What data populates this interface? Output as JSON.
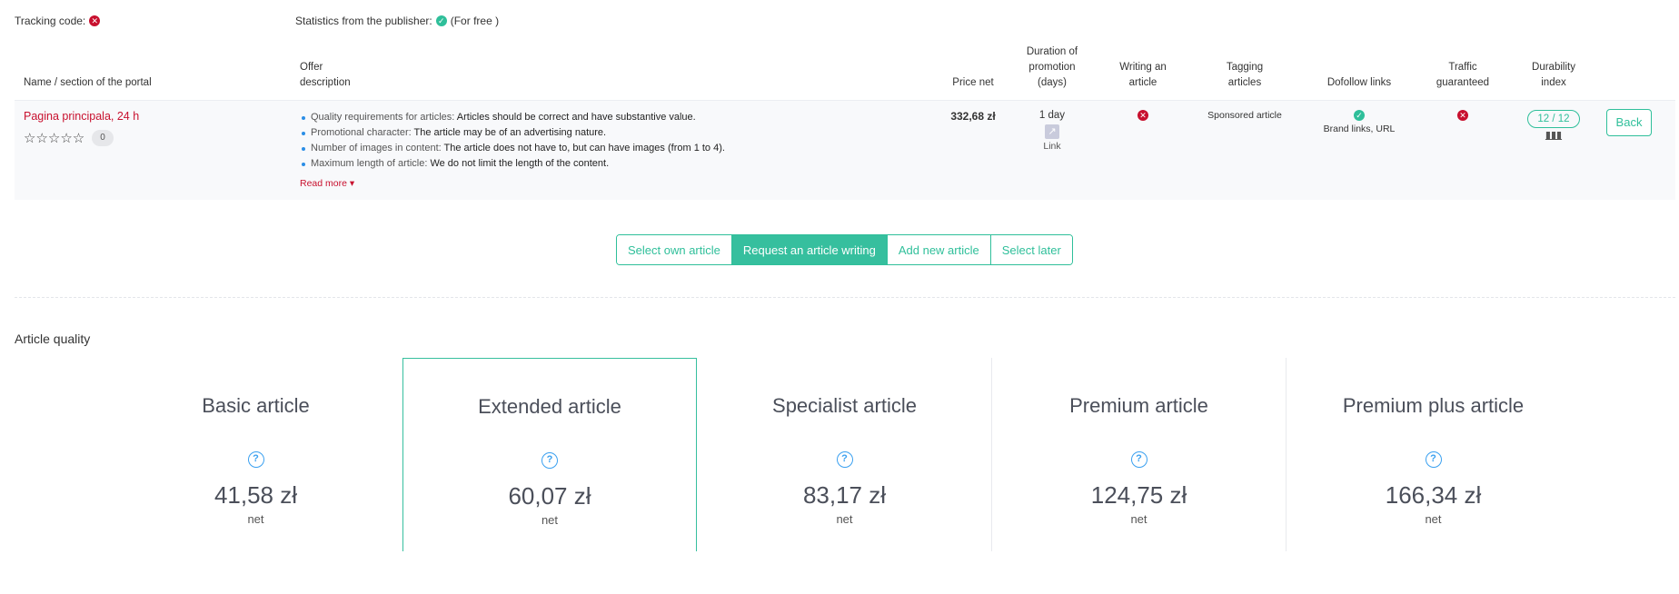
{
  "info": {
    "tracking_code_label": "Tracking code:",
    "tracking_code_status": "no",
    "statistics_label": "Statistics from the publisher:",
    "statistics_status": "yes",
    "statistics_note": "(For free )"
  },
  "table": {
    "headers": {
      "name": "Name / section of the portal",
      "offer_line1": "Offer",
      "offer_line2": "description",
      "price": "Price net",
      "duration_line1": "Duration of",
      "duration_line2": "promotion",
      "duration_line3": "(days)",
      "writing_line1": "Writing an",
      "writing_line2": "article",
      "tagging_line1": "Tagging",
      "tagging_line2": "articles",
      "dofollow": "Dofollow links",
      "traffic_line1": "Traffic",
      "traffic_line2": "guaranteed",
      "durability_line1": "Durability",
      "durability_line2": "index"
    },
    "row": {
      "portal_name": "Pagina principala, 24 h",
      "stars": "☆☆☆☆☆",
      "rating_count": "0",
      "description": [
        {
          "label": "Quality requirements for articles:",
          "value": "Articles should be correct and have substantive value."
        },
        {
          "label": "Promotional character:",
          "value": "The article may be of an advertising nature."
        },
        {
          "label": "Number of images in content:",
          "value": "The article does not have to, but can have images (from 1 to 4)."
        },
        {
          "label": "Maximum length of article:",
          "value": "We do not limit the length of the content."
        }
      ],
      "read_more": "Read more ▾",
      "price": "332,68 zł",
      "duration": "1 day",
      "duration_link": "Link",
      "writing_article": "no",
      "tagging": "Sponsored article",
      "dofollow": "yes",
      "dofollow_note": "Brand links, URL",
      "traffic_guaranteed": "no",
      "durability": "12 / 12",
      "back_button": "Back"
    }
  },
  "actions": {
    "buttons": [
      {
        "label": "Select own article",
        "active": false
      },
      {
        "label": "Request an article writing",
        "active": true
      },
      {
        "label": "Add new article",
        "active": false
      },
      {
        "label": "Select later",
        "active": false
      }
    ]
  },
  "article_quality": {
    "title": "Article quality",
    "cards": [
      {
        "title": "Basic article",
        "price": "41,58 zł",
        "unit": "net",
        "selected": false
      },
      {
        "title": "Extended article",
        "price": "60,07 zł",
        "unit": "net",
        "selected": true
      },
      {
        "title": "Specialist article",
        "price": "83,17 zł",
        "unit": "net",
        "selected": false
      },
      {
        "title": "Premium article",
        "price": "124,75 zł",
        "unit": "net",
        "selected": false
      },
      {
        "title": "Premium plus article",
        "price": "166,34 zł",
        "unit": "net",
        "selected": false
      }
    ]
  },
  "colors": {
    "accent": "#36bf9e",
    "danger": "#c8102e",
    "info": "#3aa0f0"
  }
}
